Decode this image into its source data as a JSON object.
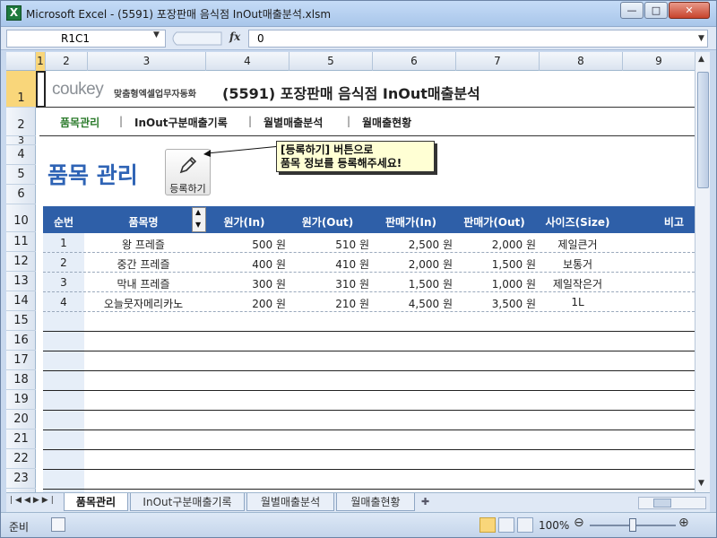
{
  "window": {
    "title": "Microsoft Excel - (5591) 포장판매 음식점 InOut매출분석.xlsm",
    "app_icon": "X",
    "minimize_glyph": "—",
    "maximize_glyph": "□",
    "close_glyph": "✕"
  },
  "formula_bar": {
    "name_box": "R1C1",
    "fx_label": "fx",
    "formula_value": "0"
  },
  "columns": [
    "1",
    "2",
    "3",
    "4",
    "5",
    "6",
    "7",
    "8",
    "9"
  ],
  "rows": [
    "1",
    "2",
    "3",
    "4",
    "5",
    "6",
    "10",
    "11",
    "12",
    "13",
    "14",
    "15",
    "16",
    "17",
    "18",
    "19",
    "20",
    "21",
    "22",
    "23"
  ],
  "banner": {
    "brand": "coukey",
    "brand_sub": "맞춤형엑셀업무자동화",
    "title": "(5591) 포장판매 음식점 InOut매출분석"
  },
  "nav_tabs": [
    "품목관리",
    "InOut구분매출기록",
    "월별매출분석",
    "월매출현황"
  ],
  "section": {
    "title": "품목 관리",
    "register_button": "등록하기",
    "callout_line1": "[등록하기] 버튼으로",
    "callout_line2": "품목 정보를 등록해주세요!"
  },
  "table": {
    "headers": [
      "순번",
      "품목명",
      "원가(In)",
      "원가(Out)",
      "판매가(In)",
      "판매가(Out)",
      "사이즈(Size)",
      "비고"
    ],
    "rows": [
      [
        "1",
        "왕 프레즐",
        "500 원",
        "510 원",
        "2,500 원",
        "2,000 원",
        "제일큰거",
        ""
      ],
      [
        "2",
        "중간 프레즐",
        "400 원",
        "410 원",
        "2,000 원",
        "1,500 원",
        "보통거",
        ""
      ],
      [
        "3",
        "막내 프레즐",
        "300 원",
        "310 원",
        "1,500 원",
        "1,000 원",
        "제일작은거",
        ""
      ],
      [
        "4",
        "오늘뭇자메리카노",
        "200 원",
        "210 원",
        "4,500 원",
        "3,500 원",
        "1L",
        ""
      ]
    ]
  },
  "sheet_tabs": [
    "품목관리",
    "InOut구분매출기록",
    "월별매출분석",
    "월매출현황"
  ],
  "status": {
    "mode": "준비",
    "zoom": "100%"
  },
  "colors": {
    "table_header": "#2e5fa8",
    "nav_active": "#2a7a2a",
    "section_title": "#2e63b5",
    "callout_bg": "#ffffd4"
  }
}
